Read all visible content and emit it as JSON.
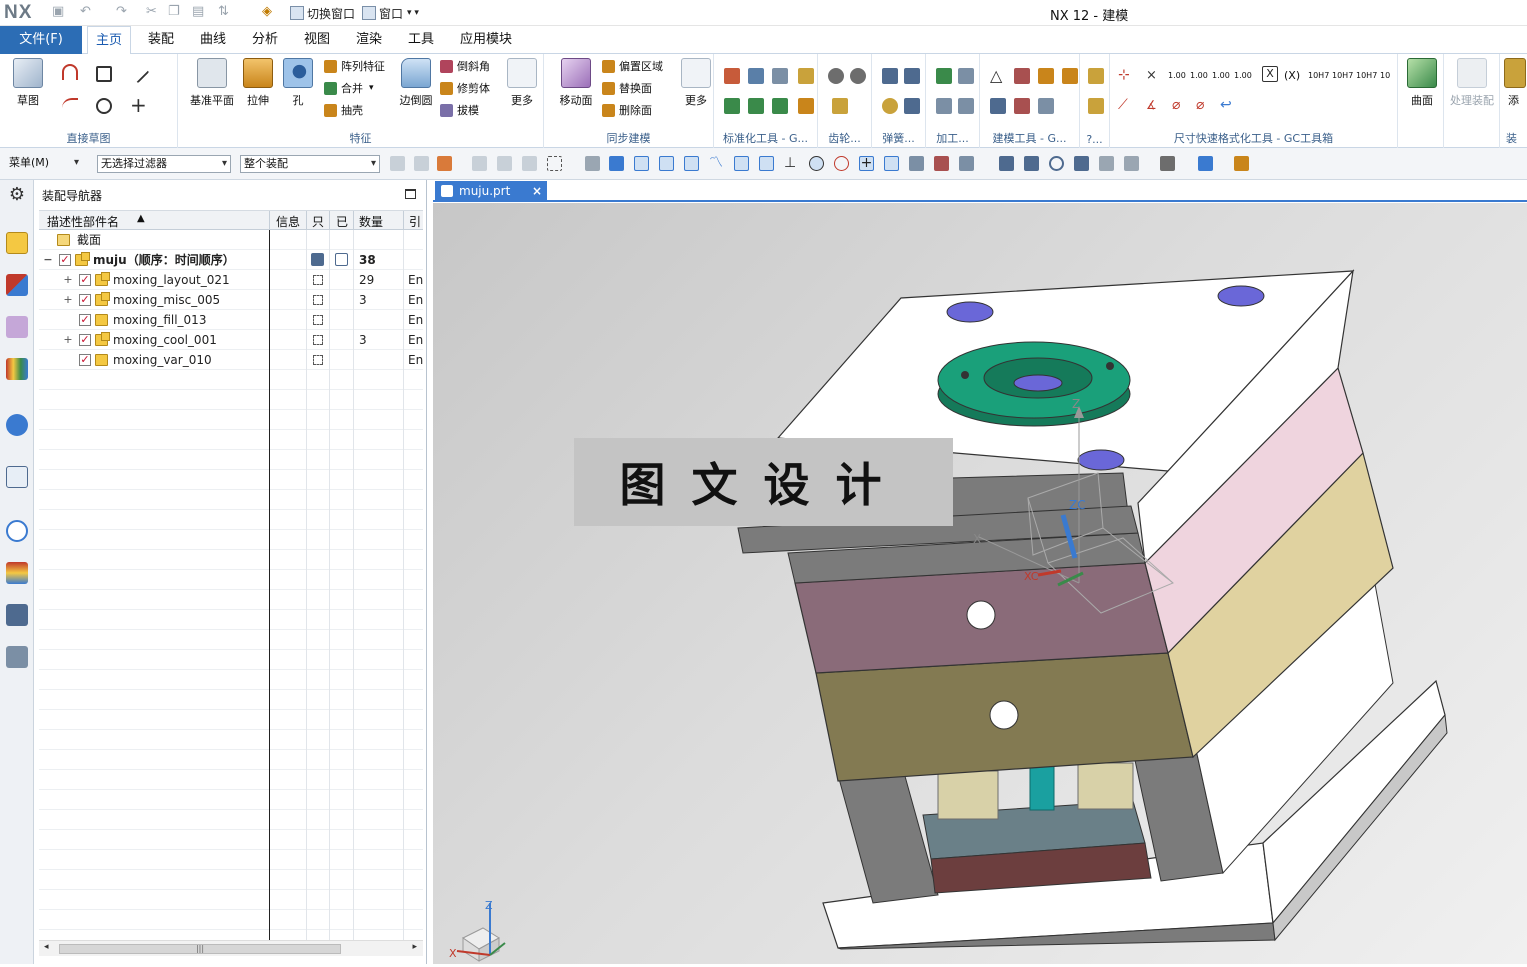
{
  "app": {
    "logo": "NX",
    "title": "NX 12 - 建模"
  },
  "quick_access": {
    "switch_window": "切换窗口",
    "window": "窗口"
  },
  "menu": {
    "file": "文件(F)",
    "tabs": [
      "主页",
      "装配",
      "曲线",
      "分析",
      "视图",
      "渲染",
      "工具",
      "应用模块"
    ],
    "active_tab": "主页"
  },
  "ribbon": {
    "groups": {
      "direct_sketch": "直接草图",
      "feature": "特征",
      "sync_modeling": "同步建模",
      "standard_tools": "标准化工具 - G...",
      "gear": "齿轮...",
      "spring": "弹簧...",
      "machining": "加工...",
      "modeling_tools": "建模工具 - G...",
      "misc": "?...",
      "dimension_tools": "尺寸快速格式化工具 - GC工具箱",
      "surface_group": "装"
    },
    "buttons": {
      "sketch": "草图",
      "datum_plane": "基准平面",
      "extrude": "拉伸",
      "hole": "孔",
      "pattern_feature": "阵列特征",
      "unite": "合并",
      "shell": "抽壳",
      "edge_blend": "边倒圆",
      "chamfer": "倒斜角",
      "trim_body": "修剪体",
      "draft": "拔模",
      "more1": "更多",
      "move_face": "移动面",
      "offset_region": "偏置区域",
      "replace_face": "替换面",
      "delete_face": "删除面",
      "more2": "更多",
      "surface": "曲面",
      "wave_assembly": "处理装配",
      "add": "添"
    },
    "dim_labels": [
      "1.00",
      "1.00",
      "1.00",
      "1.00",
      "10H7",
      "10H7",
      "10H7",
      "10"
    ]
  },
  "selection_bar": {
    "menu": "菜单(M)",
    "filter": "无选择过滤器",
    "scope": "整个装配"
  },
  "navigator": {
    "title": "装配导航器",
    "columns": [
      "描述性部件名",
      "信息",
      "只",
      "已",
      "数量",
      "引"
    ],
    "rows": [
      {
        "name": "截面",
        "type": "folder"
      },
      {
        "name": "muju（顺序：时间顺序）",
        "type": "root",
        "count": "38"
      },
      {
        "name": "moxing_layout_021",
        "type": "asm",
        "count": "29",
        "ref": "En"
      },
      {
        "name": "moxing_misc_005",
        "type": "asm",
        "count": "3",
        "ref": "En"
      },
      {
        "name": "moxing_fill_013",
        "type": "part",
        "count": "",
        "ref": "En"
      },
      {
        "name": "moxing_cool_001",
        "type": "asm",
        "count": "3",
        "ref": "En"
      },
      {
        "name": "moxing_var_010",
        "type": "part",
        "count": "",
        "ref": "En"
      }
    ]
  },
  "document": {
    "tab": "muju.prt"
  },
  "viewport": {
    "watermark": "图文设计",
    "axis_labels": {
      "z": "Z",
      "zc": "ZC",
      "x": "X",
      "xc": "XC"
    },
    "triad": {
      "z": "Z",
      "x": "X"
    }
  },
  "colors": {
    "accent": "#2c6db5",
    "teal": "#1aa07a",
    "plate_purple": "#8a6b79",
    "plate_olive": "#837a52",
    "plate_pink": "#efd4de",
    "plate_tan": "#e0d2a0",
    "steel": "#7b7b7b"
  }
}
